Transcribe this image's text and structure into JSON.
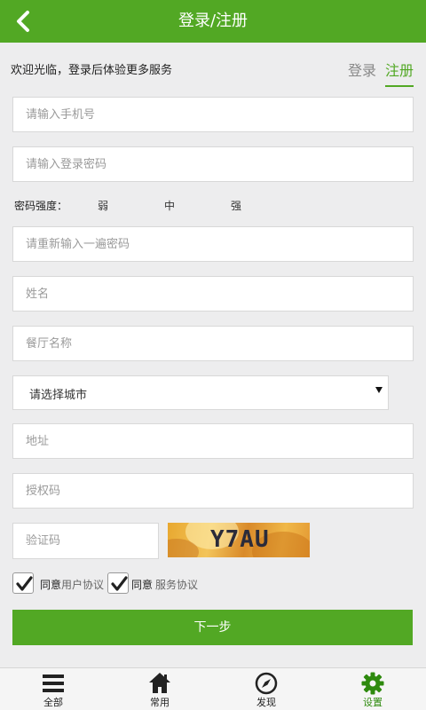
{
  "header": {
    "title": "登录/注册"
  },
  "welcome": "欢迎光临，登录后体验更多服务",
  "tabs": {
    "login": "登录",
    "register": "注册"
  },
  "form": {
    "phone_placeholder": "请输入手机号",
    "password_placeholder": "请输入登录密码",
    "strength_label": "密码强度：",
    "strength_weak": "弱",
    "strength_medium": "中",
    "strength_strong": "强",
    "confirm_placeholder": "请重新输入一遍密码",
    "name_placeholder": "姓名",
    "restaurant_placeholder": "餐厅名称",
    "city_select": "请选择城市",
    "address_placeholder": "地址",
    "auth_code_placeholder": "授权码",
    "captcha_placeholder": "验证码",
    "captcha_text": "Y7AU"
  },
  "agreements": {
    "agree1": "同意",
    "link1": "用户协议",
    "agree2": "同意",
    "link2": "服务协议"
  },
  "next_button": "下一步",
  "tabbar": [
    {
      "label": "全部",
      "icon": "menu-icon"
    },
    {
      "label": "常用",
      "icon": "home-icon"
    },
    {
      "label": "发现",
      "icon": "compass-icon"
    },
    {
      "label": "设置",
      "icon": "gear-icon",
      "active": true
    }
  ],
  "colors": {
    "accent": "#52a824",
    "active_tab": "#2e8a0e"
  }
}
